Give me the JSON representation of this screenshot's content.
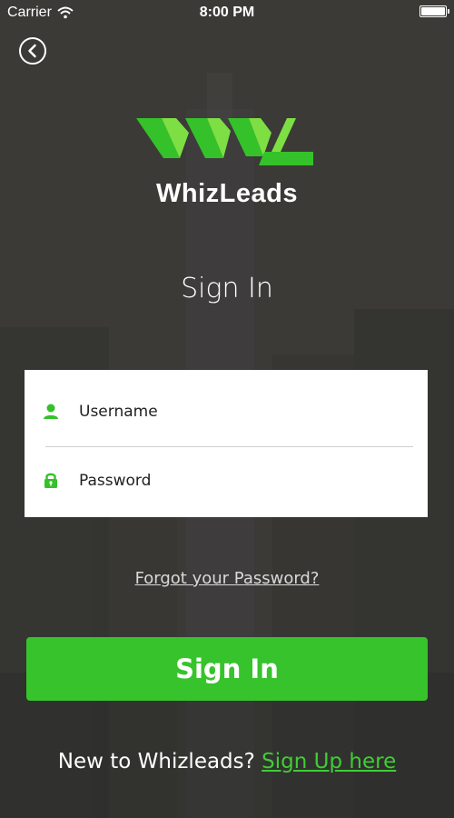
{
  "status_bar": {
    "carrier": "Carrier",
    "time": "8:00 PM"
  },
  "brand": {
    "name": "WhizLeads",
    "accent_color": "#37c32c",
    "logo_light_green": "#7ddf43"
  },
  "back_icon": "chevron-left-icon",
  "title": "Sign In",
  "form": {
    "username": {
      "icon": "user-icon",
      "placeholder": "Username",
      "value": ""
    },
    "password": {
      "icon": "lock-icon",
      "placeholder": "Password",
      "value": ""
    }
  },
  "forgot_password_label": "Forgot your Password?",
  "sign_in_button_label": "Sign In",
  "signup": {
    "prompt": "New to Whizleads?",
    "link_label": "Sign Up here"
  }
}
